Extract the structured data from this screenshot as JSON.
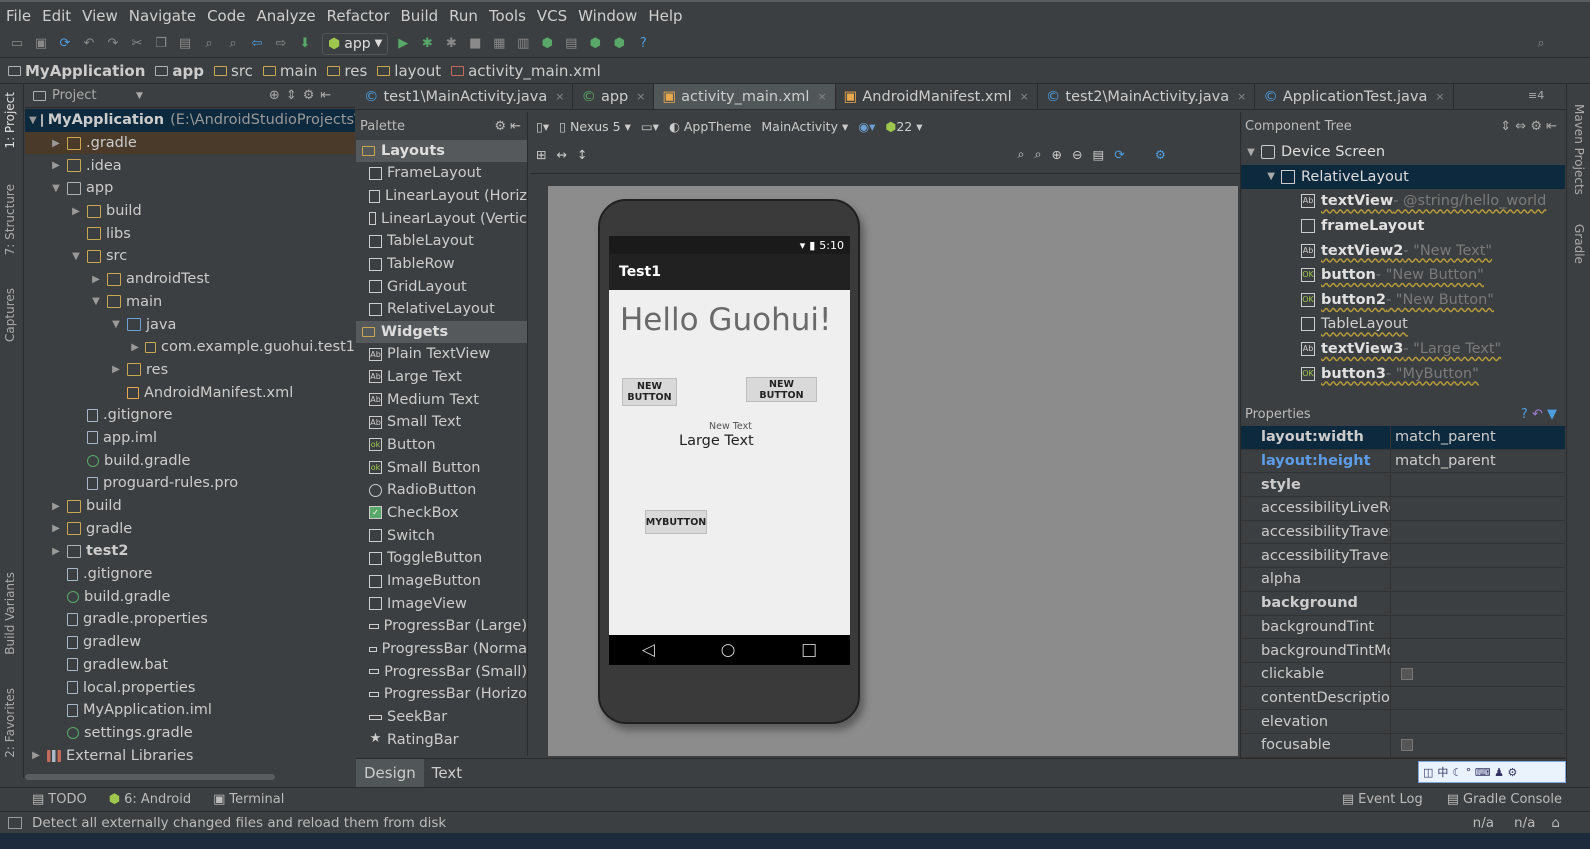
{
  "menu": [
    "File",
    "Edit",
    "View",
    "Navigate",
    "Code",
    "Analyze",
    "Refactor",
    "Build",
    "Run",
    "Tools",
    "VCS",
    "Window",
    "Help"
  ],
  "toolbar": {
    "run_config": "app",
    "icons": [
      "open-icon",
      "save-icon",
      "sync-icon",
      "undo-icon",
      "redo-icon",
      "cut-icon",
      "copy-icon",
      "paste-icon",
      "find-icon",
      "replace-icon",
      "back-icon",
      "forward-icon",
      "build-icon",
      "run-icon",
      "debug-icon",
      "attach-icon",
      "stop-icon",
      "sdk-manager-icon",
      "avd-manager-icon",
      "project-structure-icon",
      "android-device-monitor-icon",
      "help-icon"
    ]
  },
  "breadcrumb": [
    "MyApplication",
    "app",
    "src",
    "main",
    "res",
    "layout",
    "activity_main.xml"
  ],
  "left_stripe": [
    "1: Project",
    "7: Structure",
    "Captures",
    "Build Variants",
    "2: Favorites"
  ],
  "right_stripe": [
    "Maven Projects",
    "Gradle"
  ],
  "project_panel": {
    "view": "Project"
  },
  "tree": [
    {
      "label": "MyApplication",
      "path": "(E:\\AndroidStudioProjects\\M",
      "indent": 0,
      "arrow": "▼",
      "icon": "mod",
      "bold": true,
      "sel": true
    },
    {
      "label": ".gradle",
      "indent": 1,
      "arrow": "▶",
      "icon": "folder",
      "hl": true
    },
    {
      "label": ".idea",
      "indent": 1,
      "arrow": "▶",
      "icon": "folder"
    },
    {
      "label": "app",
      "indent": 1,
      "arrow": "▼",
      "icon": "mod"
    },
    {
      "label": "build",
      "indent": 2,
      "arrow": "▶",
      "icon": "folder"
    },
    {
      "label": "libs",
      "indent": 2,
      "arrow": "",
      "icon": "folder"
    },
    {
      "label": "src",
      "indent": 2,
      "arrow": "▼",
      "icon": "folder"
    },
    {
      "label": "androidTest",
      "indent": 3,
      "arrow": "▶",
      "icon": "folder"
    },
    {
      "label": "main",
      "indent": 3,
      "arrow": "▼",
      "icon": "folder"
    },
    {
      "label": "java",
      "indent": 4,
      "arrow": "▼",
      "icon": "blue"
    },
    {
      "label": "com.example.guohui.test1",
      "indent": 5,
      "arrow": "▶",
      "icon": "pkg"
    },
    {
      "label": "res",
      "indent": 4,
      "arrow": "▶",
      "icon": "folder"
    },
    {
      "label": "AndroidManifest.xml",
      "indent": 4,
      "arrow": "",
      "icon": "xml"
    },
    {
      "label": ".gitignore",
      "indent": 2,
      "arrow": "",
      "icon": "file"
    },
    {
      "label": "app.iml",
      "indent": 2,
      "arrow": "",
      "icon": "file"
    },
    {
      "label": "build.gradle",
      "indent": 2,
      "arrow": "",
      "icon": "gradle"
    },
    {
      "label": "proguard-rules.pro",
      "indent": 2,
      "arrow": "",
      "icon": "file"
    },
    {
      "label": "build",
      "indent": 1,
      "arrow": "▶",
      "icon": "folder"
    },
    {
      "label": "gradle",
      "indent": 1,
      "arrow": "▶",
      "icon": "folder"
    },
    {
      "label": "test2",
      "indent": 1,
      "arrow": "▶",
      "icon": "mod",
      "bold": true
    },
    {
      "label": ".gitignore",
      "indent": 1,
      "arrow": "",
      "icon": "file"
    },
    {
      "label": "build.gradle",
      "indent": 1,
      "arrow": "",
      "icon": "gradle"
    },
    {
      "label": "gradle.properties",
      "indent": 1,
      "arrow": "",
      "icon": "file"
    },
    {
      "label": "gradlew",
      "indent": 1,
      "arrow": "",
      "icon": "file"
    },
    {
      "label": "gradlew.bat",
      "indent": 1,
      "arrow": "",
      "icon": "file"
    },
    {
      "label": "local.properties",
      "indent": 1,
      "arrow": "",
      "icon": "file"
    },
    {
      "label": "MyApplication.iml",
      "indent": 1,
      "arrow": "",
      "icon": "file"
    },
    {
      "label": "settings.gradle",
      "indent": 1,
      "arrow": "",
      "icon": "gradle"
    },
    {
      "label": "External Libraries",
      "indent": 0,
      "arrow": "▶",
      "icon": "lib"
    }
  ],
  "editor_tabs": [
    {
      "label": "test1\\MainActivity.java",
      "active": false
    },
    {
      "label": "app",
      "active": false
    },
    {
      "label": "activity_main.xml",
      "active": true
    },
    {
      "label": "AndroidManifest.xml",
      "active": false
    },
    {
      "label": "test2\\MainActivity.java",
      "active": false
    },
    {
      "label": "ApplicationTest.java",
      "active": false
    }
  ],
  "tab_overflow": "≡4",
  "palette": {
    "title": "Palette",
    "sections": [
      {
        "name": "Layouts",
        "items": [
          "FrameLayout",
          "LinearLayout (Horiz",
          "LinearLayout (Vertic",
          "TableLayout",
          "TableRow",
          "GridLayout",
          "RelativeLayout"
        ]
      },
      {
        "name": "Widgets",
        "items": [
          "Plain TextView",
          "Large Text",
          "Medium Text",
          "Small Text",
          "Button",
          "Small Button",
          "RadioButton",
          "CheckBox",
          "Switch",
          "ToggleButton",
          "ImageButton",
          "ImageView",
          "ProgressBar (Large)",
          "ProgressBar (Norma",
          "ProgressBar (Small)",
          "ProgressBar (Horizo",
          "SeekBar",
          "RatingBar"
        ]
      }
    ]
  },
  "design_toolbar": {
    "device": "Nexus 5",
    "theme": "AppTheme",
    "activity": "MainActivity",
    "api": "22"
  },
  "preview": {
    "time": "5:10",
    "app_title": "Test1",
    "hello": "Hello Guohui!",
    "button1": "NEW\nBUTTON",
    "button2": "NEW BUTTON",
    "small_text": "New Text",
    "large_text": "Large Text",
    "button3": "MYBUTTON"
  },
  "component_tree": {
    "title": "Component Tree",
    "root": "Device Screen",
    "layout": "RelativeLayout",
    "children": [
      {
        "name": "textView",
        "value": " - @string/hello_world",
        "icon": "Ab"
      },
      {
        "name": "frameLayout",
        "value": "",
        "icon": ""
      },
      {
        "name": "textView2",
        "value": " - \"New Text\"",
        "icon": "Ab"
      },
      {
        "name": "button",
        "value": " - \"New Button\"",
        "icon": "OK"
      },
      {
        "name": "button2",
        "value": " - \"New Button\"",
        "icon": "OK"
      },
      {
        "name": "TableLayout",
        "value": "",
        "icon": "tb"
      },
      {
        "name": "textView3",
        "value": " - \"Large Text\"",
        "icon": "Ab"
      },
      {
        "name": "button3",
        "value": " - \"MyButton\"",
        "icon": "OK"
      }
    ]
  },
  "properties": {
    "title": "Properties",
    "rows": [
      {
        "k": "layout:width",
        "v": "match_parent",
        "bold": true,
        "hl": true
      },
      {
        "k": "layout:height",
        "v": "match_parent",
        "bold": true,
        "blue": true
      },
      {
        "k": "style",
        "v": "",
        "bold": true
      },
      {
        "k": "accessibilityLiveReg",
        "v": ""
      },
      {
        "k": "accessibilityTraversa",
        "v": ""
      },
      {
        "k": "accessibilityTraversa",
        "v": ""
      },
      {
        "k": "alpha",
        "v": ""
      },
      {
        "k": "background",
        "v": "",
        "bold": true
      },
      {
        "k": "backgroundTint",
        "v": ""
      },
      {
        "k": "backgroundTintMo",
        "v": ""
      },
      {
        "k": "clickable",
        "v": "",
        "check": true
      },
      {
        "k": "contentDescription",
        "v": ""
      },
      {
        "k": "elevation",
        "v": ""
      },
      {
        "k": "focusable",
        "v": "",
        "check": true
      }
    ]
  },
  "editor_bottom_tabs": [
    "Design",
    "Text"
  ],
  "tool_windows": {
    "todo": "TODO",
    "android": "6: Android",
    "terminal": "Terminal",
    "event_log": "Event Log",
    "gradle_console": "Gradle Console"
  },
  "status": {
    "message": "Detect all externally changed files and reload them from disk",
    "pos1": "n/a",
    "pos2": "n/a"
  },
  "ime": "中"
}
